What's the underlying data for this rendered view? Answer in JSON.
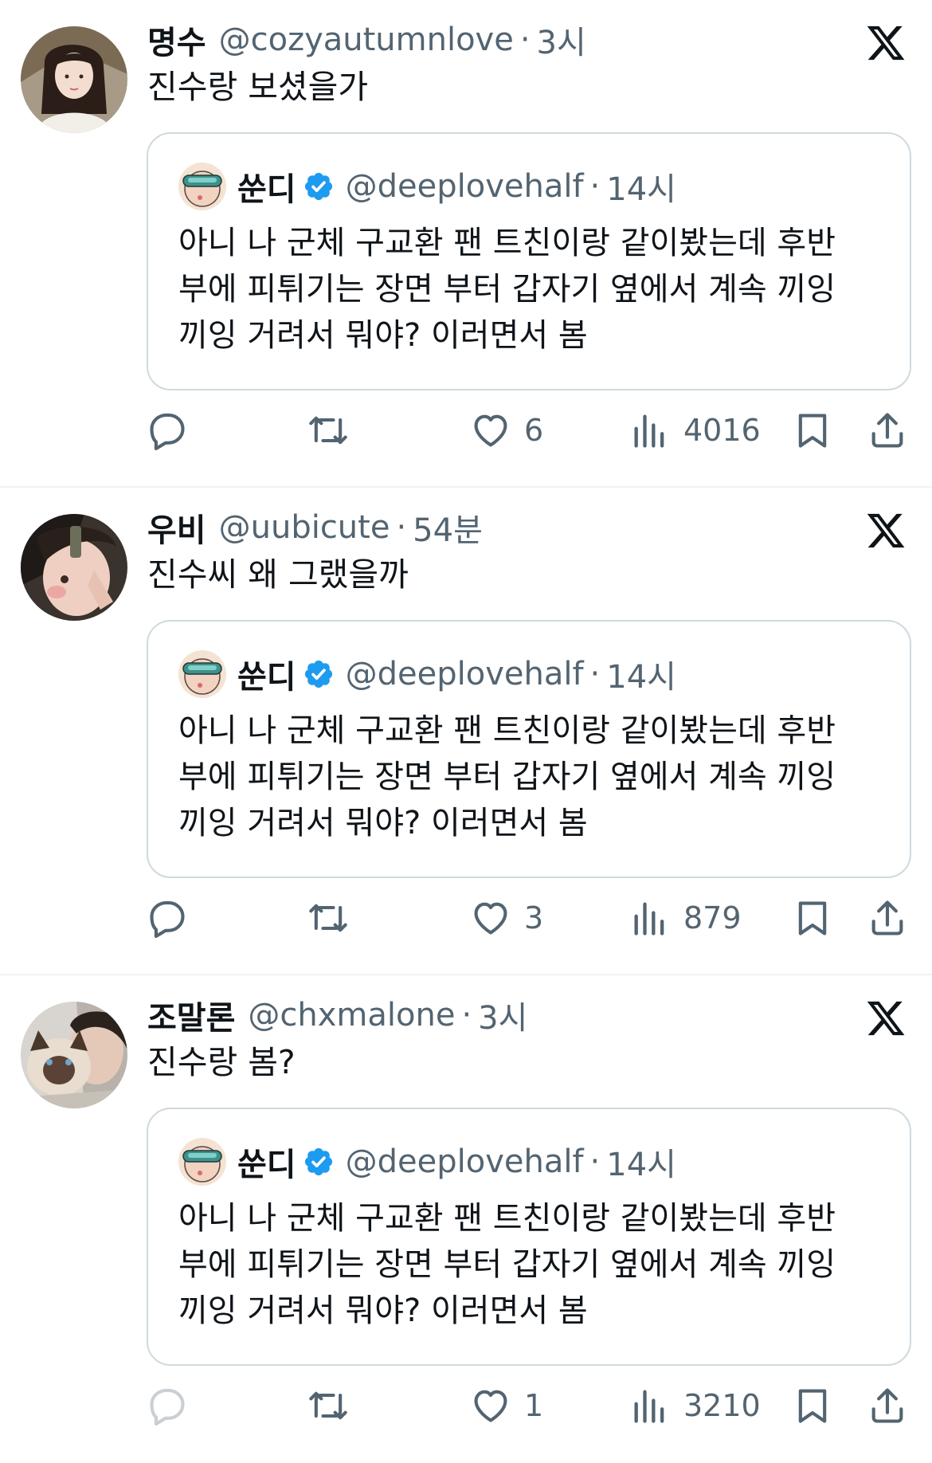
{
  "quoted_tweet": {
    "name": "쑨디",
    "handle": "@deeplovehalf",
    "separator": "·",
    "time": "14시",
    "lines": [
      "아니 나 군체 구교환 팬 트친이랑 같이봤는데 후반",
      "부에 피튀기는 장면 부터 갑자기 옆에서 계속 끼잉",
      "끼잉 거려서 뭐야? 이러면서 봄"
    ]
  },
  "tweets": [
    {
      "name": "명수",
      "handle": "@cozyautumnlove",
      "separator": "·",
      "time": "3시",
      "text": "진수랑 보셨을가",
      "likes": "6",
      "views": "4016"
    },
    {
      "name": "우비",
      "handle": "@uubicute",
      "separator": "·",
      "time": "54분",
      "text": "진수씨 왜 그랬을까",
      "likes": "3",
      "views": "879"
    },
    {
      "name": "조말론",
      "handle": "@chxmalone",
      "separator": "·",
      "time": "3시",
      "text": "진수랑 봄?",
      "likes": "1",
      "views": "3210"
    }
  ],
  "icons": {
    "reply": "reply-icon",
    "retweet": "retweet-icon",
    "like": "heart-icon",
    "views": "views-icon",
    "bookmark": "bookmark-icon",
    "share": "share-icon",
    "brand": "x-logo-icon",
    "verified": "verified-badge-icon"
  },
  "colors": {
    "text": "#0f1419",
    "secondary": "#536471",
    "border": "#cfd9de",
    "divider": "#eff3f4",
    "verified": "#1d9bf0"
  }
}
